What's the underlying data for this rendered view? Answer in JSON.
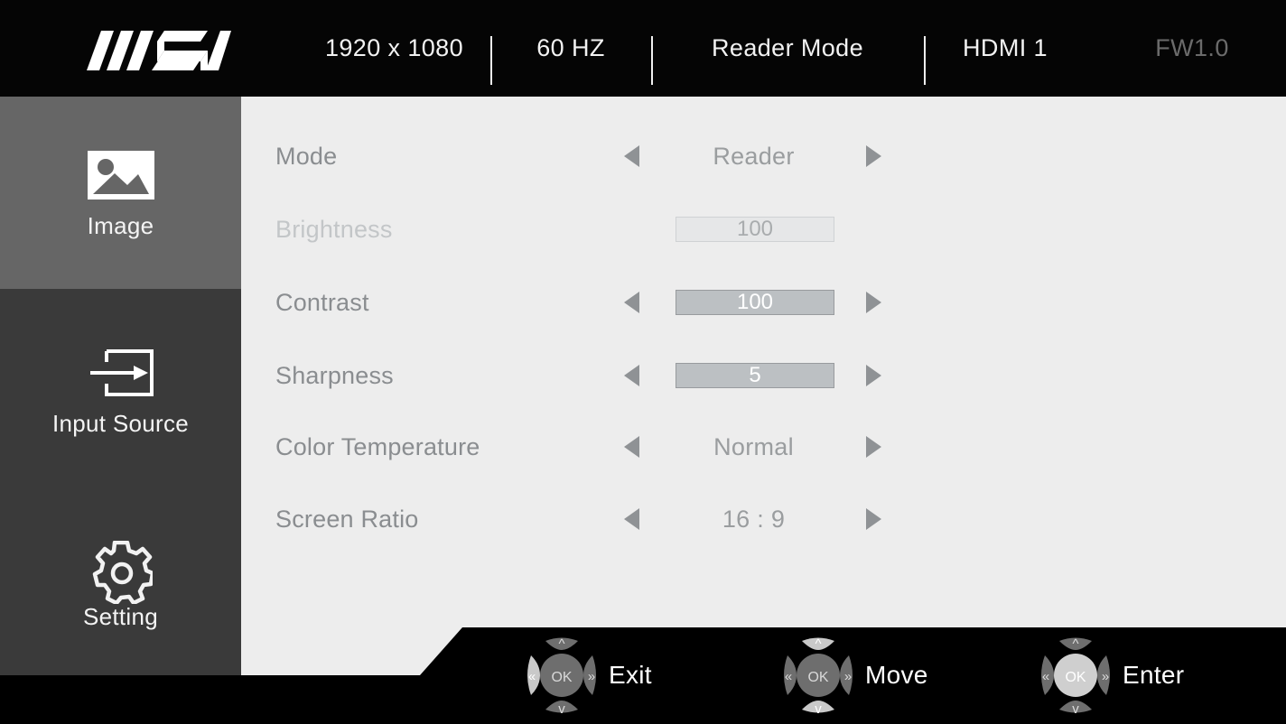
{
  "header": {
    "logo": "msi-logo",
    "resolution": "1920 x 1080",
    "refresh_rate": "60 HZ",
    "picture_mode": "Reader Mode",
    "input": "HDMI 1",
    "firmware": "FW1.0"
  },
  "sidebar": {
    "items": [
      {
        "label": "Image",
        "icon": "image-icon",
        "active": true
      },
      {
        "label": "Input Source",
        "icon": "input-source-icon",
        "active": false
      },
      {
        "label": "Setting",
        "icon": "gear-icon",
        "active": false
      }
    ]
  },
  "menu": {
    "rows": [
      {
        "label": "Mode",
        "value": "Reader",
        "type": "select",
        "enabled": true,
        "arrows": true
      },
      {
        "label": "Brightness",
        "value": "100",
        "type": "slider",
        "enabled": false,
        "arrows": false
      },
      {
        "label": "Contrast",
        "value": "100",
        "type": "slider",
        "enabled": true,
        "arrows": true
      },
      {
        "label": "Sharpness",
        "value": "5",
        "type": "slider",
        "enabled": true,
        "arrows": true
      },
      {
        "label": "Color Temperature",
        "value": "Normal",
        "type": "select",
        "enabled": true,
        "arrows": true
      },
      {
        "label": "Screen Ratio",
        "value": "16 : 9",
        "type": "select",
        "enabled": true,
        "arrows": true
      }
    ]
  },
  "footer": {
    "hints": [
      {
        "label": "Exit",
        "icon": "joystick-left-icon",
        "highlight": "left"
      },
      {
        "label": "Move",
        "icon": "joystick-up-down-icon",
        "highlight": "updown"
      },
      {
        "label": "Enter",
        "icon": "joystick-press-ok-icon",
        "highlight": "center"
      }
    ]
  },
  "colors": {
    "header_bg": "#050505",
    "panel_bg": "#ededed",
    "sidebar_bg": "#3a3a3a",
    "sidebar_active_bg": "#666666",
    "label_text": "#8a8d90",
    "disabled_text": "#c3c6c8",
    "slider_fill": "#bcc0c3",
    "footer_bg": "#000000"
  }
}
